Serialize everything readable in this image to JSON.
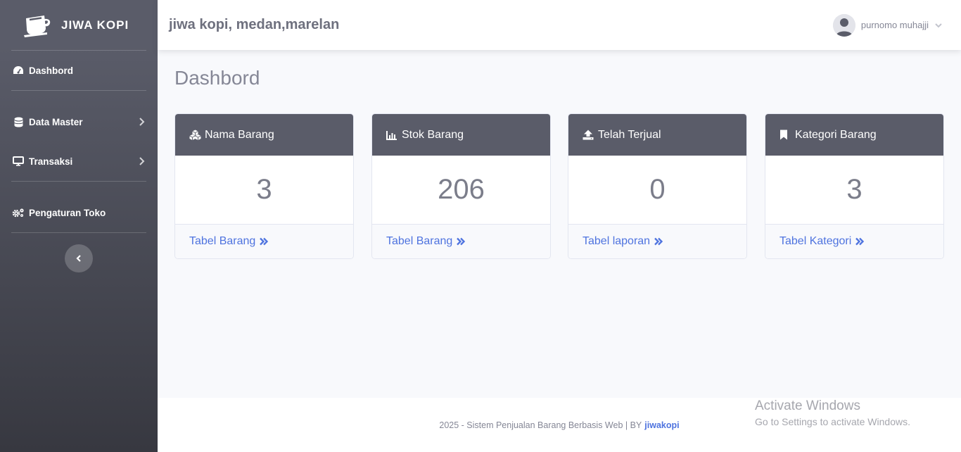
{
  "sidebar": {
    "brand": "JIWA KOPI",
    "items": [
      {
        "label": "Dashbord",
        "icon": "tachometer-icon",
        "has_chevron": false
      },
      {
        "label": "Data Master",
        "icon": "database-icon",
        "has_chevron": true
      },
      {
        "label": "Transaksi",
        "icon": "desktop-icon",
        "has_chevron": true
      },
      {
        "label": "Pengaturan Toko",
        "icon": "cogs-icon",
        "has_chevron": false
      }
    ]
  },
  "topbar": {
    "store_title": "jiwa kopi, medan,marelan",
    "user_name": "purnomo muhajji"
  },
  "main": {
    "page_title": "Dashbord",
    "cards": [
      {
        "title": "Nama Barang",
        "icon": "cubes-icon",
        "value": "3",
        "link": "Tabel Barang"
      },
      {
        "title": "Stok Barang",
        "icon": "chart-bar-icon",
        "value": "206",
        "link": "Tabel Barang"
      },
      {
        "title": "Telah Terjual",
        "icon": "upload-icon",
        "value": "0",
        "link": "Tabel laporan"
      },
      {
        "title": "Kategori Barang",
        "icon": "bookmark-icon",
        "value": "3",
        "link": "Tabel Kategori"
      }
    ]
  },
  "footer": {
    "text": "2025 - Sistem Penjualan Barang Berbasis Web | BY",
    "brand": "jiwakopi"
  },
  "watermark": {
    "title": "Activate Windows",
    "subtitle": "Go to Settings to activate Windows."
  },
  "colors": {
    "sidebar": "#5a5c69",
    "card_header": "#5a5c69",
    "link": "#4e73df",
    "background": "#f8f9fc"
  }
}
